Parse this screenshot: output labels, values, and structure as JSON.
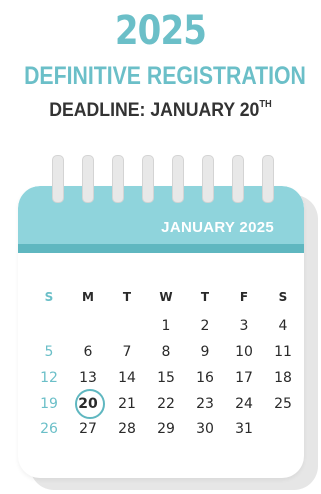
{
  "header": {
    "year": "2025",
    "title": "DEFINITIVE REGISTRATION",
    "deadline_text": "DEADLINE: JANUARY 20",
    "deadline_sup": "TH"
  },
  "calendar": {
    "month_label": "JANUARY 2025",
    "weekdays": [
      "S",
      "M",
      "T",
      "W",
      "T",
      "F",
      "S"
    ],
    "rows": [
      [
        "",
        "",
        "",
        "1",
        "2",
        "3",
        "4"
      ],
      [
        "5",
        "6",
        "7",
        "8",
        "9",
        "10",
        "11"
      ],
      [
        "12",
        "13",
        "14",
        "15",
        "16",
        "17",
        "18"
      ],
      [
        "19",
        "20",
        "21",
        "22",
        "23",
        "24",
        "25"
      ],
      [
        "26",
        "27",
        "28",
        "29",
        "30",
        "31",
        ""
      ]
    ],
    "highlighted_day": "20"
  },
  "colors": {
    "accent": "#6bbfc8",
    "header_band": "#8fd4dc",
    "band_dark": "#5fb7c0",
    "text_dark": "#333333"
  }
}
